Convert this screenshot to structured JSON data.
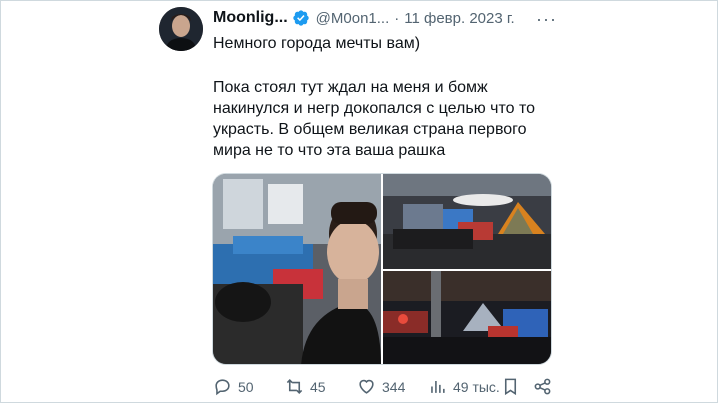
{
  "tweet": {
    "author_name": "Moonlig...",
    "handle": "@M0on1...",
    "separator": "·",
    "date": "11 февр. 2023 г.",
    "more_label": "···",
    "text_line_1": "Немного города мечты вам)",
    "text_line_2": "Пока стоял тут ждал на меня и бомж накинулся и негр докопался с целью что то украсть. В общем великая страна первого мира не то что эта ваша рашка",
    "verified": true,
    "accent_color": "#1d9bf0"
  },
  "media": {
    "photos": [
      {
        "icon": "selfie-photo"
      },
      {
        "icon": "tents-street-photo"
      },
      {
        "icon": "tents-night-photo"
      }
    ]
  },
  "actions": {
    "replies": "50",
    "retweets": "45",
    "likes": "344",
    "views": "49 тыс."
  }
}
